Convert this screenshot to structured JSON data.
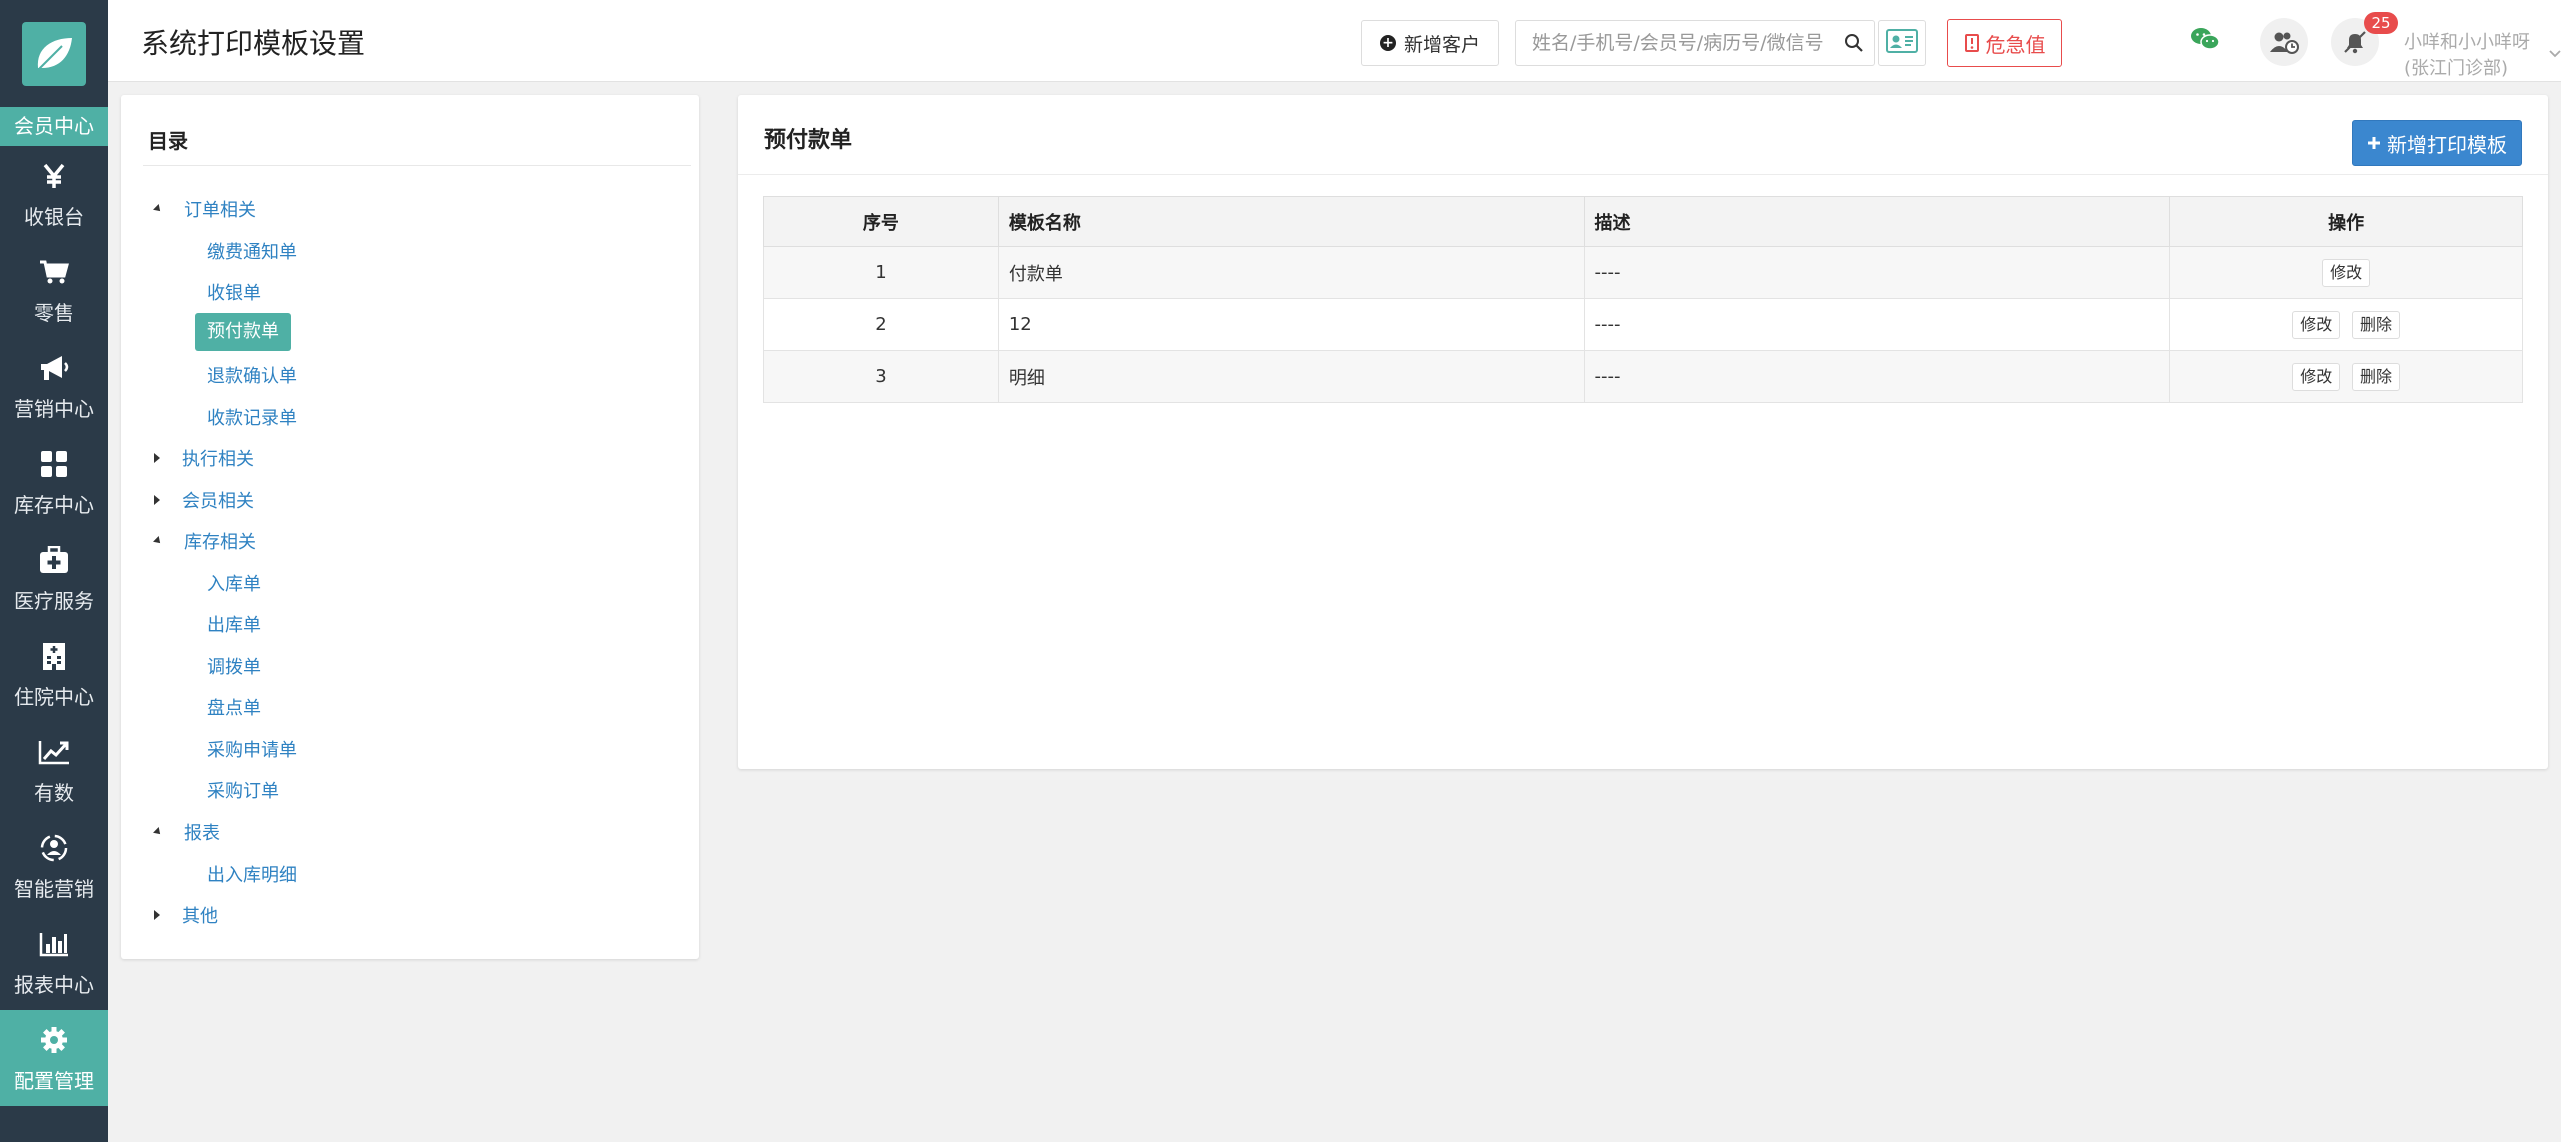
{
  "header": {
    "title": "系统打印模板设置",
    "new_customer_label": "新增客户",
    "search_placeholder": "姓名/手机号/会员号/病历号/微信号",
    "critical_label": "危急值",
    "notification_count": "25",
    "user_label": "小咩和小小咩呀 (张江门诊部)"
  },
  "sidebar": {
    "member_center": "会员中心",
    "items": [
      {
        "label": "收银台",
        "icon": "yen-icon"
      },
      {
        "label": "零售",
        "icon": "cart-icon"
      },
      {
        "label": "营销中心",
        "icon": "megaphone-icon"
      },
      {
        "label": "库存中心",
        "icon": "grid-icon"
      },
      {
        "label": "医疗服务",
        "icon": "medkit-icon"
      },
      {
        "label": "住院中心",
        "icon": "hospital-icon"
      },
      {
        "label": "有数",
        "icon": "trend-icon"
      },
      {
        "label": "智能营销",
        "icon": "smart-icon"
      },
      {
        "label": "报表中心",
        "icon": "bar-chart-icon"
      },
      {
        "label": "配置管理",
        "icon": "gear-icon"
      }
    ]
  },
  "tree": {
    "title": "目录",
    "groups": [
      {
        "label": "订单相关",
        "children": [
          "缴费通知单",
          "收银单",
          "预付款单",
          "退款确认单",
          "收款记录单"
        ]
      },
      {
        "label": "执行相关"
      },
      {
        "label": "会员相关"
      },
      {
        "label": "库存相关",
        "children": [
          "入库单",
          "出库单",
          "调拨单",
          "盘点单",
          "采购申请单",
          "采购订单"
        ]
      },
      {
        "label": "报表",
        "children": [
          "出入库明细"
        ]
      },
      {
        "label": "其他"
      }
    ]
  },
  "content": {
    "title": "预付款单",
    "add_button": "新增打印模板",
    "columns": [
      "序号",
      "模板名称",
      "描述",
      "操作"
    ],
    "rows": [
      {
        "index": "1",
        "name": "付款单",
        "desc": "----",
        "edit": "修改"
      },
      {
        "index": "2",
        "name": "12",
        "desc": "----",
        "edit": "修改",
        "delete": "删除"
      },
      {
        "index": "3",
        "name": "明细",
        "desc": "----",
        "edit": "修改",
        "delete": "删除"
      }
    ]
  },
  "colors": {
    "sidebar_bg": "#2b3a48",
    "accent_teal": "#4fb0a5",
    "primary_blue": "#3b87cf",
    "danger_red": "#e84c4c",
    "link_blue": "#2f82c2"
  }
}
